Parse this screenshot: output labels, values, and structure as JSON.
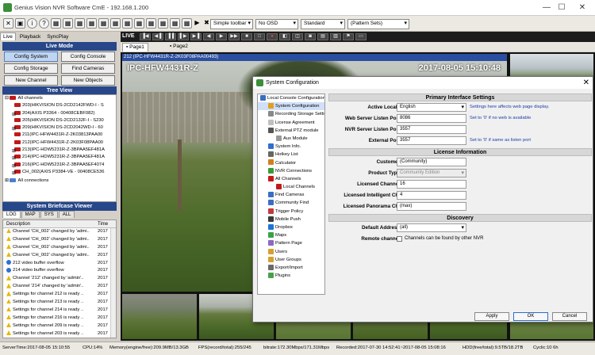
{
  "window": {
    "title": "Genius Vision NVR Software CmE - 192.168.1.200",
    "min": "—",
    "max": "☐",
    "close": "✕"
  },
  "toolbar": {
    "layout_select": "Simple toolbar",
    "osd_select": "No OSD",
    "quality_select": "Standard",
    "pattern_select": "(Pattern Sets)"
  },
  "nav_tabs": [
    "Live",
    "Playback",
    "SyncPlay"
  ],
  "live_mode": {
    "header": "Live Mode",
    "buttons": [
      "Config System",
      "Config Console",
      "Config Storage",
      "Find Cameras",
      "New Channel",
      "New Objects"
    ]
  },
  "tree": {
    "header": "Tree View",
    "root": "All channels",
    "items": [
      "203(HIKVISION DS-2CD2142FWD-I - S",
      "204(AXIS P3364 - 00408CEBF082)",
      "205(HIKVISION DS-2CD2132F-I - S230",
      "209(HIKVISION DS-2CD2042WD-I - 60",
      "211(IPC-HFW4431R-Z-2K03813PAA00",
      "212(IPC-HFW4431R-Z-2K03F08PAA00",
      "213(IPC-HDW5231R-Z-3BPAA5EF481A",
      "214(IPC-HDW5231R-Z-3BPAA5EF481A",
      "216(IPC-HDW5231R-Z-3BPAA5EF4074",
      "CH_002(AXIS P3384-VE - 00408CE536"
    ],
    "connections": "All connections"
  },
  "briefcase": {
    "header": "System Briefcase Viewer",
    "tabs": [
      "LOG",
      "MAP",
      "SYS",
      "ALL"
    ],
    "col_desc": "Description",
    "col_time": "Time",
    "rows": [
      {
        "type": "warn",
        "desc": "Channel 'CH_002' changed by 'admi..",
        "time": "2017"
      },
      {
        "type": "warn",
        "desc": "Channel 'CH_002' changed by 'admi..",
        "time": "2017"
      },
      {
        "type": "warn",
        "desc": "Channel 'CH_002' changed by 'admi..",
        "time": "2017"
      },
      {
        "type": "warn",
        "desc": "Channel 'CH_002' changed by 'admi..",
        "time": "2017"
      },
      {
        "type": "info",
        "desc": "212 video buffer overflow",
        "time": "2017"
      },
      {
        "type": "info",
        "desc": "214 video buffer overflow",
        "time": "2017"
      },
      {
        "type": "warn",
        "desc": "Channel '212' changed by 'admin'..",
        "time": "2017"
      },
      {
        "type": "warn",
        "desc": "Channel '214' changed by 'admin'..",
        "time": "2017"
      },
      {
        "type": "warn",
        "desc": "Settings for channel 212 is ready ..",
        "time": "2017"
      },
      {
        "type": "warn",
        "desc": "Settings for channel 213 is ready ..",
        "time": "2017"
      },
      {
        "type": "warn",
        "desc": "Settings for channel 214 is ready ..",
        "time": "2017"
      },
      {
        "type": "warn",
        "desc": "Settings for channel 216 is ready ..",
        "time": "2017"
      },
      {
        "type": "warn",
        "desc": "Settings for channel 209 is ready ..",
        "time": "2017"
      },
      {
        "type": "warn",
        "desc": "Settings for channel 203 is ready ..",
        "time": "2017"
      },
      {
        "type": "warn",
        "desc": "Settings for channel 205 is ready ..",
        "time": "2017"
      }
    ]
  },
  "status": {
    "server_time": "ServerTime:2017-08-05 15:10:55",
    "cpu": "CPU:14%",
    "memory": "Memory(engine/free):209.9MB/13.3GB",
    "fps": "FPS(record/total):255/245",
    "bitrate": "bitrate:172.30Mbps/171.31Mbps",
    "recorded": "Recorded:2017-07-30 14:52:41~2017-08-05 15:08:16",
    "hdd": "HDD(free/total):9.5TB/18.2TB",
    "cyclic": "Cyclic:10 6h"
  },
  "live_label": "LIVE",
  "page_tabs": [
    "Page1",
    "Page2"
  ],
  "main_cam": {
    "bar": "212 (IPC-HFW4431R-Z-2K03F08PAA00493)",
    "name": "IPC-HFW4431R-Z",
    "timestamp": "2017-08-05 15:10:48"
  },
  "dialog": {
    "title": "System Configuration",
    "close": "✕",
    "tree": [
      {
        "label": "Local Console Configuration",
        "indent": 0,
        "color": "#3a6ec2"
      },
      {
        "label": "System Configuration",
        "indent": 1,
        "color": "#e0a020"
      },
      {
        "label": "Recording Storage Settings",
        "indent": 1,
        "color": "#888888"
      },
      {
        "label": "License Agreement",
        "indent": 1,
        "color": "#c0c0c0"
      },
      {
        "label": "External PTZ module",
        "indent": 1,
        "color": "#555555"
      },
      {
        "label": "Aux Module",
        "indent": 2,
        "color": "#999999"
      },
      {
        "label": "System Info.",
        "indent": 1,
        "color": "#2f6fd0"
      },
      {
        "label": "Hotkey List",
        "indent": 1,
        "color": "#666666"
      },
      {
        "label": "Calculator",
        "indent": 1,
        "color": "#d08020"
      },
      {
        "label": "NVR Connections",
        "indent": 1,
        "color": "#3a9a3a"
      },
      {
        "label": "All Channels",
        "indent": 1,
        "color": "#c21a1a"
      },
      {
        "label": "Local Channels",
        "indent": 2,
        "color": "#c21a1a"
      },
      {
        "label": "Find Cameras",
        "indent": 1,
        "color": "#3a6ec2"
      },
      {
        "label": "Community Find",
        "indent": 1,
        "color": "#3a6ec2"
      },
      {
        "label": "Trigger Policy",
        "indent": 1,
        "color": "#c23a3a"
      },
      {
        "label": "Mobile Push",
        "indent": 1,
        "color": "#3a3a3a"
      },
      {
        "label": "Dropbox",
        "indent": 1,
        "color": "#1e73d6"
      },
      {
        "label": "Maps",
        "indent": 1,
        "color": "#3aa04a"
      },
      {
        "label": "Pattern Page",
        "indent": 1,
        "color": "#8a6ac2"
      },
      {
        "label": "Users",
        "indent": 1,
        "color": "#d6a030"
      },
      {
        "label": "User Groups",
        "indent": 1,
        "color": "#d6a030"
      },
      {
        "label": "Export/Import",
        "indent": 1,
        "color": "#6a6a6a"
      },
      {
        "label": "Plugins",
        "indent": 1,
        "color": "#4aa04a"
      }
    ],
    "primary": {
      "header": "Primary Interface Settings",
      "active_locale_label": "Active Locale",
      "active_locale_value": "English",
      "active_locale_note": "Settings here affects web page display.",
      "web_port_label": "Web Server Listen Port",
      "web_port_value": "8086",
      "web_port_note": "Set to '0' if no web is available",
      "nvr_port_label": "NVR Server Listen Port",
      "nvr_port_value": "3557",
      "ext_port_label": "External Port",
      "ext_port_value": "3557",
      "ext_port_note": "Set to '0' if same as listen port"
    },
    "license": {
      "header": "License Information",
      "customer_label": "Customer",
      "customer_value": "(Community)",
      "product_label": "Product Type",
      "product_value": "Community Edition",
      "channel_label": "Licensed Channel",
      "channel_value": "16",
      "intelligent_label": "Licensed Intelligent Ch.",
      "intelligent_value": "4",
      "panorama_label": "Licensed Panorama Ch.",
      "panorama_value": "(max)"
    },
    "discovery": {
      "header": "Discovery",
      "address_label": "Default Address",
      "address_value": "(all)",
      "remote_label": "Remote channel",
      "remote_text": "Channels can be found by other NVR"
    },
    "buttons": {
      "apply": "Apply",
      "ok": "OK",
      "cancel": "Cancel"
    }
  }
}
